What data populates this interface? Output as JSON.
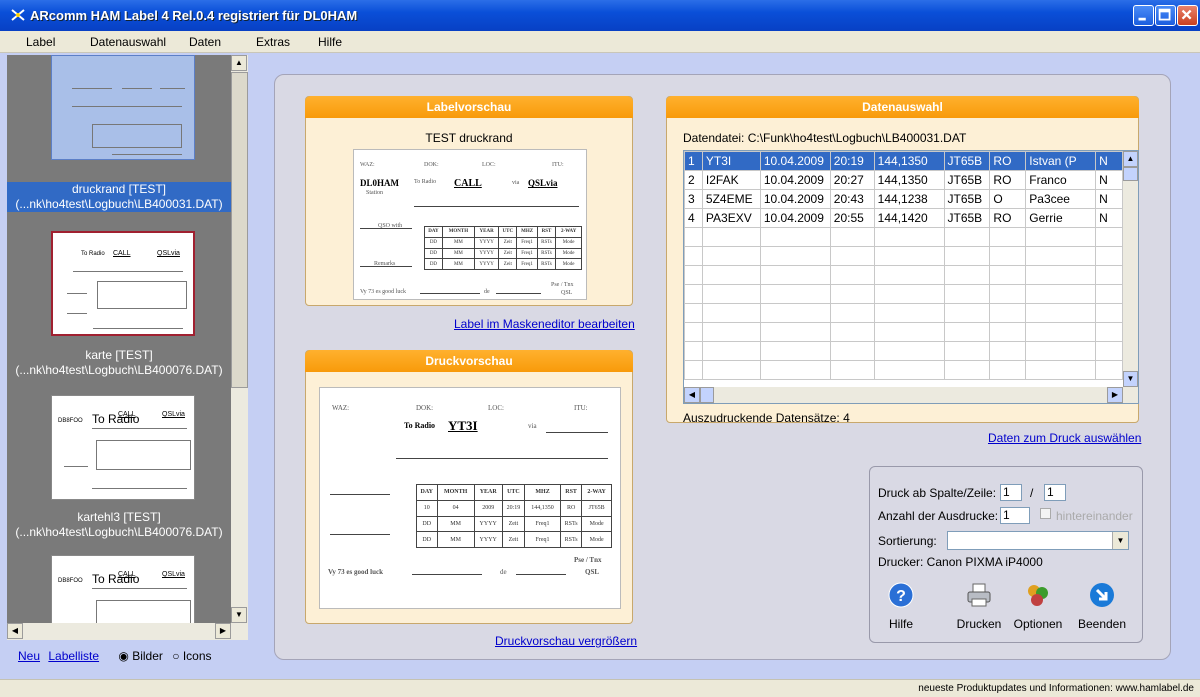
{
  "window": {
    "title": "ARcomm HAM Label  4 Rel.0.4 registriert für DL0HAM"
  },
  "menu": [
    "Label",
    "Datenauswahl",
    "Daten",
    "Extras",
    "Hilfe"
  ],
  "thumbnails": [
    {
      "label1": "druckrand [TEST]",
      "label2": "(...nk\\ho4test\\Logbuch\\LB400031.DAT)",
      "selected": true
    },
    {
      "label1": "karte [TEST]",
      "label2": "(...nk\\ho4test\\Logbuch\\LB400076.DAT)",
      "selected": false
    },
    {
      "label1": "kartehl3 [TEST]",
      "label2": "(...nk\\ho4test\\Logbuch\\LB400076.DAT)",
      "selected": false
    }
  ],
  "thumb_text": {
    "call": "CALL",
    "qsl": "QSLvia",
    "toradio": "To Radio",
    "call_sign": "DB8FOO"
  },
  "leftbottom": {
    "neu": "Neu",
    "labelliste": "Labelliste",
    "bilder": "Bilder",
    "icons": "Icons"
  },
  "labelvorschau": {
    "header": "Labelvorschau",
    "name": "TEST druckrand",
    "edit_link": "Label im Maskeneditor bearbeiten"
  },
  "card": {
    "waz": "WAZ:",
    "dok": "DOK:",
    "loc": "LOC:",
    "itu": "ITU:",
    "call_big": "DL0HAM",
    "to_radio": "To Radio",
    "call": "CALL",
    "via": "via",
    "qslvia": "QSLvia",
    "station": "Station",
    "qso_label": "QSO with",
    "remark": "Remarks",
    "vy": "Vy 73 es good luck",
    "de": "de",
    "pse": "Pse / Tnx",
    "qsl": "QSL",
    "grid_head": [
      "DAY",
      "MONTH",
      "YEAR",
      "UTC",
      "MHZ",
      "RST",
      "2-WAY"
    ],
    "grid_rows": [
      [
        "DD",
        "MM",
        "YYYY",
        "Zeit",
        "Freq1",
        "RSTs",
        "Mode"
      ],
      [
        "DD",
        "MM",
        "YYYY",
        "Zeit",
        "Freq1",
        "RSTs",
        "Mode"
      ],
      [
        "DD",
        "MM",
        "YYYY",
        "Zeit",
        "Freq1",
        "RSTs",
        "Mode"
      ]
    ]
  },
  "druckvorschau": {
    "header": "Druckvorschau",
    "enlarge_link": "Druckvorschau vergrößern",
    "call": "YT3I",
    "via": "via",
    "to_radio": "To Radio",
    "vy": "Vy 73 es good luck",
    "de": "de",
    "pse": "Pse / Tnx",
    "qsl": "QSL",
    "grid_head": [
      "DAY",
      "MONTH",
      "YEAR",
      "UTC",
      "MHZ",
      "RST",
      "2-WAY"
    ],
    "grid_rows": [
      [
        "10",
        "04",
        "2009",
        "20:19",
        "144,1350",
        "RO",
        "JT65B"
      ],
      [
        "DD",
        "MM",
        "YYYY",
        "Zeit",
        "Freq1",
        "RSTs",
        "Mode"
      ],
      [
        "DD",
        "MM",
        "YYYY",
        "Zeit",
        "Freq1",
        "RSTs",
        "Mode"
      ]
    ]
  },
  "datenauswahl": {
    "header": "Datenauswahl",
    "datei": "Datendatei: C:\\Funk\\ho4test\\Logbuch\\LB400031.DAT",
    "rows": [
      [
        "1",
        "YT3I",
        "10.04.2009",
        "20:19",
        "144,1350",
        "JT65B",
        "RO",
        "Istvan (P",
        "N"
      ],
      [
        "2",
        "I2FAK",
        "10.04.2009",
        "20:27",
        "144,1350",
        "JT65B",
        "RO",
        "Franco",
        "N"
      ],
      [
        "3",
        "5Z4EME",
        "10.04.2009",
        "20:43",
        "144,1238",
        "JT65B",
        "O",
        "Pa3cee",
        "N"
      ],
      [
        "4",
        "PA3EXV",
        "10.04.2009",
        "20:55",
        "144,1420",
        "JT65B",
        "RO",
        "Gerrie",
        "N"
      ]
    ],
    "count": "Auszudruckende Datensätze: 4",
    "select_link": "Daten zum Druck auswählen"
  },
  "options": {
    "druck_ab": "Druck ab Spalte/Zeile:",
    "col": "1",
    "slash": "/",
    "row": "1",
    "anzahl": "Anzahl der Ausdrucke:",
    "anzahl_val": "1",
    "hinter": "hintereinander",
    "sortierung": "Sortierung:",
    "drucker": "Drucker: Canon PIXMA iP4000"
  },
  "buttons": {
    "hilfe": "Hilfe",
    "drucken": "Drucken",
    "optionen": "Optionen",
    "beenden": "Beenden"
  },
  "status": "neueste Produktupdates und Informationen: www.hamlabel.de"
}
